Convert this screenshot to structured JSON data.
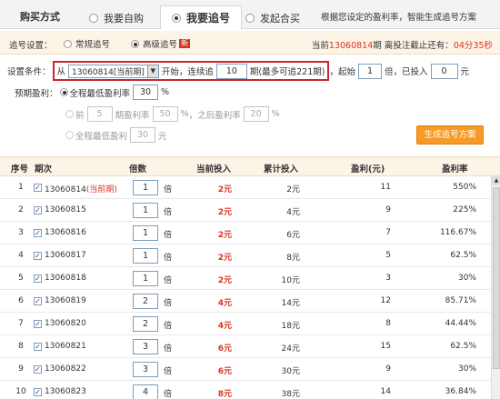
{
  "tabbar": {
    "title": "购买方式",
    "tabs": [
      {
        "label": "我要自购",
        "selected": false
      },
      {
        "label": "我要追号",
        "selected": true
      },
      {
        "label": "发起合买",
        "selected": false
      }
    ],
    "hint": "根据您设定的盈利率，智能生成追号方案"
  },
  "subbar": {
    "label": "追号设置：",
    "options": [
      {
        "label": "常规追号",
        "selected": false
      },
      {
        "label": "高级追号",
        "selected": true,
        "badge": "新"
      }
    ],
    "period_prefix": "当前",
    "period": "13060814",
    "period_mid": "期 离投注截止还有：",
    "countdown": "04分35秒"
  },
  "settings": {
    "cond_label": "设置条件：",
    "from_label": "从",
    "start_select": "13060814[当前期]",
    "start_label": "开始，连续追",
    "count": "10",
    "count_suffix": "期",
    "max_note": "(最多可追221期)",
    "start_mult_label": "，起始",
    "start_mult": "1",
    "mult_unit": "倍",
    "invested_label": "，已投入",
    "invested": "0",
    "yuan": "元",
    "expected_label": "预期盈利：",
    "opt_min_rate_label": "全程最低盈利率",
    "opt_min_rate": "30",
    "percent": "%",
    "opt_front_label": "前",
    "opt_front_periods": "5",
    "opt_front_rate_label": "期盈利率",
    "opt_front_rate": "50",
    "opt_after_label": "，之后盈利率",
    "opt_after_rate": "20",
    "opt_min_profit_label": "全程最低盈利",
    "opt_min_profit": "30",
    "generate_button": "生成追号方案"
  },
  "table": {
    "headers": [
      "序号",
      "期次",
      "倍数",
      "当前投入",
      "累计投入",
      "盈利(元)",
      "盈利率"
    ],
    "current_tag": "(当前期)",
    "mult_unit": "倍",
    "rows": [
      {
        "idx": "1",
        "period": "13060814",
        "mult": "1",
        "cur": "2元",
        "total": "2元",
        "profit": "11",
        "rate": "550%"
      },
      {
        "idx": "2",
        "period": "13060815",
        "mult": "1",
        "cur": "2元",
        "total": "4元",
        "profit": "9",
        "rate": "225%"
      },
      {
        "idx": "3",
        "period": "13060816",
        "mult": "1",
        "cur": "2元",
        "total": "6元",
        "profit": "7",
        "rate": "116.67%"
      },
      {
        "idx": "4",
        "period": "13060817",
        "mult": "1",
        "cur": "2元",
        "total": "8元",
        "profit": "5",
        "rate": "62.5%"
      },
      {
        "idx": "5",
        "period": "13060818",
        "mult": "1",
        "cur": "2元",
        "total": "10元",
        "profit": "3",
        "rate": "30%"
      },
      {
        "idx": "6",
        "period": "13060819",
        "mult": "2",
        "cur": "4元",
        "total": "14元",
        "profit": "12",
        "rate": "85.71%"
      },
      {
        "idx": "7",
        "period": "13060820",
        "mult": "2",
        "cur": "4元",
        "total": "18元",
        "profit": "8",
        "rate": "44.44%"
      },
      {
        "idx": "8",
        "period": "13060821",
        "mult": "3",
        "cur": "6元",
        "total": "24元",
        "profit": "15",
        "rate": "62.5%"
      },
      {
        "idx": "9",
        "period": "13060822",
        "mult": "3",
        "cur": "6元",
        "total": "30元",
        "profit": "9",
        "rate": "30%"
      },
      {
        "idx": "10",
        "period": "13060823",
        "mult": "4",
        "cur": "8元",
        "total": "38元",
        "profit": "14",
        "rate": "36.84%"
      }
    ]
  }
}
